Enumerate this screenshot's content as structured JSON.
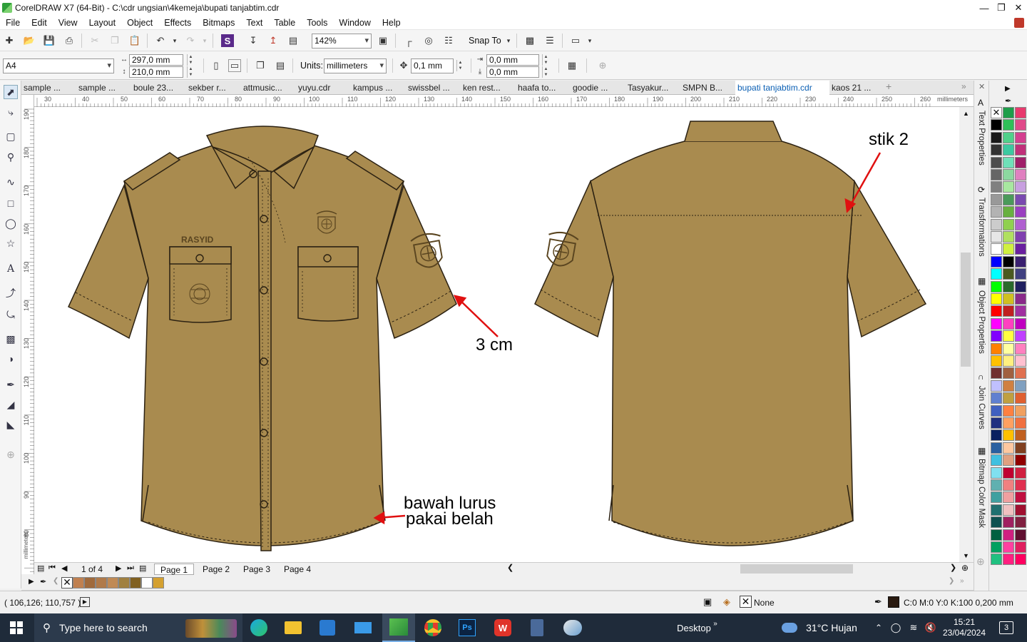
{
  "window": {
    "title": "CorelDRAW X7 (64-Bit) - C:\\cdr ungsian\\4kemeja\\bupati tanjabtim.cdr"
  },
  "menu": [
    "File",
    "Edit",
    "View",
    "Layout",
    "Object",
    "Effects",
    "Bitmaps",
    "Text",
    "Table",
    "Tools",
    "Window",
    "Help"
  ],
  "toolbar": {
    "zoom": "142%",
    "snap_to": "Snap To"
  },
  "property_bar": {
    "page_size": "A4",
    "width": "297,0 mm",
    "height": "210,0 mm",
    "units_label": "Units:",
    "units": "millimeters",
    "nudge": "0,1 mm",
    "dup_x": "0,0 mm",
    "dup_y": "0,0 mm"
  },
  "doc_tabs": [
    "sample ...",
    "sample ...",
    "boule 23...",
    "sekber r...",
    "attmusic...",
    "yuyu.cdr",
    "kampus ...",
    "swissbel ...",
    "ken rest...",
    "haafa to...",
    "goodie ...",
    "Tasyakur...",
    "SMPN B...",
    "bupati tanjabtim.cdr",
    "kaos 21 ..."
  ],
  "active_tab": "bupati tanjabtim.cdr",
  "ruler": {
    "h_ticks": [
      "30",
      "40",
      "50",
      "60",
      "70",
      "80",
      "90",
      "100",
      "110",
      "120",
      "130",
      "140",
      "150",
      "160",
      "170",
      "180",
      "190",
      "200",
      "210",
      "220",
      "230",
      "240",
      "250",
      "260"
    ],
    "h_unit": "millimeters",
    "v_ticks": [
      "190",
      "180",
      "170",
      "160",
      "150",
      "140",
      "130",
      "120",
      "110",
      "100",
      "90",
      "80"
    ],
    "v_unit": "millimeters"
  },
  "canvas": {
    "name_text": "RASYID",
    "annotations": [
      "stik 2",
      "3 cm",
      "bawah lurus",
      "pakai belah"
    ]
  },
  "pages": {
    "indicator": "1 of 4",
    "tabs": [
      "Page 1",
      "Page 2",
      "Page 3",
      "Page 4"
    ],
    "active": "Page 1"
  },
  "dockers": [
    "Text Properties",
    "Transformations",
    "Object Properties",
    "Join Curves",
    "Bitmap Color Mask"
  ],
  "status": {
    "coords": "( 106,126; 110,757 )",
    "fill": "None",
    "outline": "C:0 M:0 Y:0 K:100  0,200 mm"
  },
  "taskbar": {
    "search_placeholder": "Type here to search",
    "desktop": "Desktop",
    "weather": "31°C  Hujan",
    "time": "15:21",
    "date": "23/04/2024",
    "notifications": "3"
  },
  "colors": {
    "shirt": "#a98b4f",
    "shirt_line": "#2b2112",
    "accent_blue": "#0a5fb4",
    "arrow_red": "#e01010",
    "taskbar_bg": "#1f2b3a"
  },
  "palette_colors": [
    "#ffffff",
    "#1e9e4a",
    "#e83a6e",
    "#000000",
    "#2fbf58",
    "#e04a8a",
    "#1a1a1a",
    "#50d08a",
    "#d44090",
    "#333333",
    "#3cc9a0",
    "#c0307a",
    "#4d4d4d",
    "#6fe0b8",
    "#a0206a",
    "#666666",
    "#8cd8a0",
    "#e080c0",
    "#808080",
    "#a8e8a0",
    "#c8a0e0",
    "#999999",
    "#4a9a5a",
    "#7a4ab0",
    "#b3b3b3",
    "#68b040",
    "#9a40c0",
    "#cccccc",
    "#90d050",
    "#b060d0",
    "#e6e6e6",
    "#b0e060",
    "#8040b0",
    "#ffffff",
    "#d0f040",
    "#6a20a0",
    "#0000ff",
    "#000000",
    "#3a2070",
    "#00ffff",
    "#4a5a20",
    "#404080",
    "#00ff00",
    "#2a6a2a",
    "#202060",
    "#ffff00",
    "#d0c020",
    "#8a2a8a",
    "#ff0000",
    "#c02020",
    "#a030a0",
    "#ff00ff",
    "#ff40c0",
    "#c000c0",
    "#8000ff",
    "#ffff40",
    "#c040ff",
    "#ff8000",
    "#ffffa0",
    "#ff80c0",
    "#ffc000",
    "#fff080",
    "#ffc0d0",
    "#703030",
    "#a06040",
    "#e07050",
    "#c0c0ff",
    "#d08040",
    "#80a0c0",
    "#6080d0",
    "#c0a040",
    "#e06030",
    "#4060c0",
    "#ff8040",
    "#f0a060",
    "#203080",
    "#ffa060",
    "#f07040",
    "#0a2060",
    "#ffc000",
    "#c06020",
    "#2a60a0",
    "#ffc8a0",
    "#804020",
    "#40c0e0",
    "#e0a080",
    "#900000",
    "#80e0f0",
    "#c00030",
    "#d02040",
    "#60b0b0",
    "#f08080",
    "#e03050",
    "#40a0a0",
    "#f0a0a0",
    "#c01040",
    "#207070",
    "#f0c0c0",
    "#a01030",
    "#105050",
    "#a02060",
    "#802040",
    "#006040",
    "#d02080",
    "#601030",
    "#00a060",
    "#ff40a0",
    "#e02060",
    "#20c080",
    "#ff2080",
    "#ff0060"
  ],
  "doc_palette": [
    "#c08050",
    "#a06a3c",
    "#b07a4a",
    "#c08a55",
    "#a08040",
    "#806020",
    "#ffffff",
    "#d4a030"
  ]
}
